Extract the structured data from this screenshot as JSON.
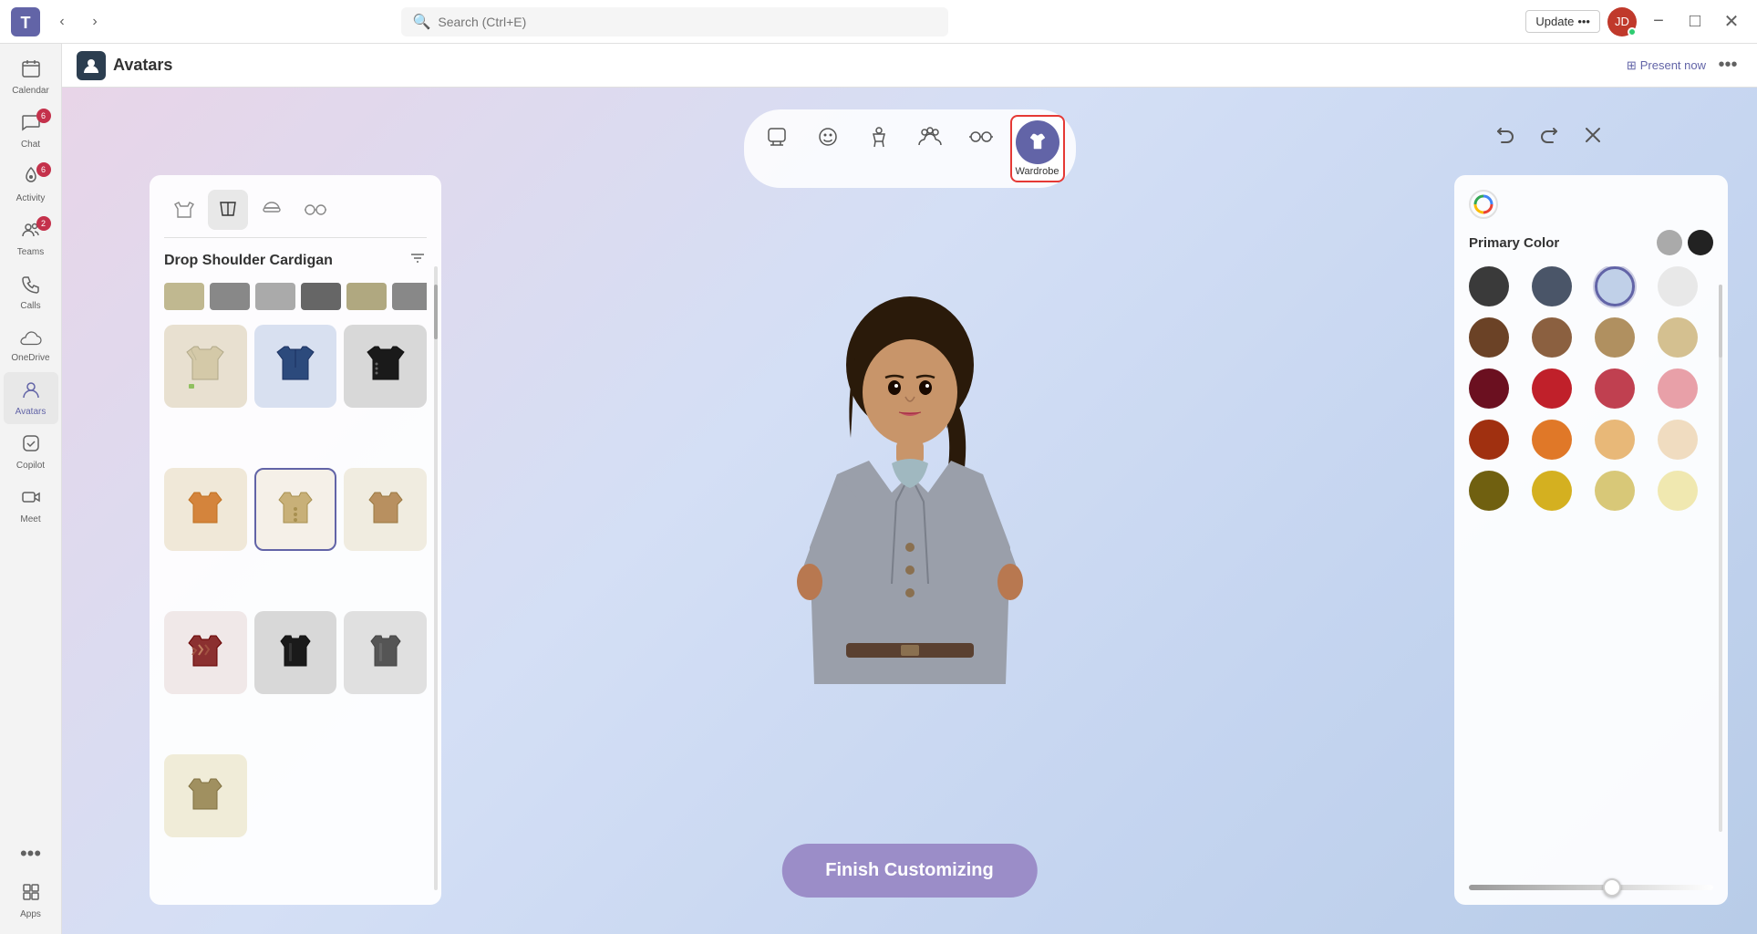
{
  "titlebar": {
    "search_placeholder": "Search (Ctrl+E)",
    "update_label": "Update",
    "update_dots": "•••",
    "minimize_label": "−",
    "maximize_label": "□",
    "close_label": "✕"
  },
  "sidebar": {
    "items": [
      {
        "id": "calendar",
        "label": "Calendar",
        "icon": "📅",
        "badge": null
      },
      {
        "id": "chat",
        "label": "Chat",
        "icon": "💬",
        "badge": "6"
      },
      {
        "id": "activity",
        "label": "Activity",
        "icon": "🔔",
        "badge": "6"
      },
      {
        "id": "teams",
        "label": "Teams",
        "icon": "👥",
        "badge": "2"
      },
      {
        "id": "calls",
        "label": "Calls",
        "icon": "📞",
        "badge": null
      },
      {
        "id": "onedrive",
        "label": "OneDrive",
        "icon": "☁",
        "badge": null
      },
      {
        "id": "avatars",
        "label": "Avatars",
        "icon": "👤",
        "badge": null,
        "active": true
      },
      {
        "id": "copilot",
        "label": "Copilot",
        "icon": "✦",
        "badge": null
      },
      {
        "id": "meet",
        "label": "Meet",
        "icon": "🎥",
        "badge": null
      }
    ],
    "more_label": "•••",
    "apps_label": "Apps",
    "apps_icon": "+"
  },
  "app_header": {
    "title": "Avatars",
    "present_now": "Present now",
    "more_icon": "•••"
  },
  "toolbar": {
    "buttons": [
      {
        "id": "avatar-select",
        "icon": "🎭",
        "label": ""
      },
      {
        "id": "face",
        "icon": "😊",
        "label": ""
      },
      {
        "id": "body",
        "icon": "🧍",
        "label": ""
      },
      {
        "id": "team",
        "icon": "👥",
        "label": ""
      },
      {
        "id": "accessories",
        "icon": "👓",
        "label": ""
      },
      {
        "id": "wardrobe",
        "icon": "👕",
        "label": "Wardrobe",
        "active": true
      }
    ],
    "undo_icon": "↩",
    "redo_icon": "↪",
    "close_icon": "✕"
  },
  "wardrobe": {
    "title": "Drop Shoulder Cardigan",
    "tabs": [
      {
        "id": "tops",
        "icon": "👕"
      },
      {
        "id": "bottoms",
        "icon": "👖",
        "active": true
      },
      {
        "id": "hats",
        "icon": "🧢"
      },
      {
        "id": "glasses",
        "icon": "👓"
      }
    ],
    "items": [
      {
        "id": 1,
        "type": "hoodie",
        "color": "#d4c9a8"
      },
      {
        "id": 2,
        "type": "jacket-blue",
        "color": "#2c4a7c"
      },
      {
        "id": 3,
        "type": "jacket-black",
        "color": "#1a1a1a"
      },
      {
        "id": 4,
        "type": "cardigan-orange",
        "color": "#d4843c"
      },
      {
        "id": 5,
        "type": "cardigan-beige",
        "color": "#c8b078",
        "selected": true
      },
      {
        "id": 6,
        "type": "jacket-tan",
        "color": "#b89060"
      },
      {
        "id": 7,
        "type": "jacket-plaid",
        "color": "#8b4040"
      },
      {
        "id": 8,
        "type": "blazer-black",
        "color": "#1a1a1a"
      },
      {
        "id": 9,
        "type": "blazer-gray",
        "color": "#555"
      },
      {
        "id": 10,
        "type": "jacket-khaki",
        "color": "#a09060"
      }
    ]
  },
  "color_panel": {
    "title": "Primary Color",
    "primary_swatches": [
      {
        "color": "#aaaaaa",
        "selected": false
      },
      {
        "color": "#222222",
        "selected": false
      }
    ],
    "colors": [
      {
        "hex": "#3a3a3a",
        "row": 0
      },
      {
        "hex": "#4a5568",
        "row": 0
      },
      {
        "hex": "#c0d0e8",
        "selected": true,
        "row": 0
      },
      {
        "hex": "#e8e8e8",
        "row": 0
      },
      {
        "hex": "#6b4226",
        "row": 1
      },
      {
        "hex": "#8b6040",
        "row": 1
      },
      {
        "hex": "#b09060",
        "row": 1
      },
      {
        "hex": "#d4c090",
        "row": 1
      },
      {
        "hex": "#6b1020",
        "row": 2
      },
      {
        "hex": "#c0202a",
        "row": 2
      },
      {
        "hex": "#c04050",
        "row": 2
      },
      {
        "hex": "#e8a0a8",
        "row": 2
      },
      {
        "hex": "#a03010",
        "row": 3
      },
      {
        "hex": "#e07828",
        "row": 3
      },
      {
        "hex": "#e8b878",
        "row": 3
      },
      {
        "hex": "#f0dcc0",
        "row": 3
      },
      {
        "hex": "#706010",
        "row": 4
      },
      {
        "hex": "#d4b020",
        "row": 4
      },
      {
        "hex": "#d8c878",
        "row": 4
      },
      {
        "hex": "#f0e8b0",
        "row": 4
      }
    ],
    "slider_value": 55
  },
  "finish_button": {
    "label": "Finish Customizing"
  }
}
